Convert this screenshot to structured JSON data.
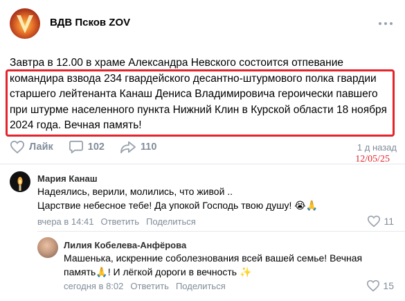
{
  "post": {
    "group_name": "ВДВ Псков ZOV",
    "text_lines": [
      "Завтра в 12.00 в храме Александра Невского состоится отпевание",
      "командира взвода 234 гвардейского десантно-штурмового полка гвардии",
      "старшего лейтенанта Канаш Дениса Владимировича героически павшего",
      "при штурме населенного пункта Нижний Клин в Курской области 18 ноября",
      "2024 года. Вечная память!"
    ],
    "like_label": "Лайк",
    "comments_count": "102",
    "shares_count": "110",
    "time": "1 д назад",
    "stamp_date": "12/05/25"
  },
  "comments": [
    {
      "author": "Мария Канаш",
      "lines": [
        "Надеялись, верили, молились, что живой ..",
        "Царствие небесное тебе! Да упокой Господь твою душу! 😭🙏"
      ],
      "time": "вчера в 14:41",
      "reply_label": "Ответить",
      "share_label": "Поделиться",
      "likes": "11"
    },
    {
      "author": "Лилия Кобелева-Анфёрова",
      "lines": [
        "Машенька, искренние соболезнования всей вашей семье! Вечная",
        "память🙏! И лёгкой дороги в вечность ✨"
      ],
      "time": "сегодня в 8:02",
      "reply_label": "Ответить",
      "share_label": "Поделиться",
      "likes": "15"
    }
  ],
  "colors": {
    "accent_red": "#e3242b",
    "muted_gray": "#818c99",
    "divider": "#e7e8ec"
  },
  "icons": [
    "more-icon",
    "heart-icon",
    "comment-icon",
    "share-icon"
  ]
}
